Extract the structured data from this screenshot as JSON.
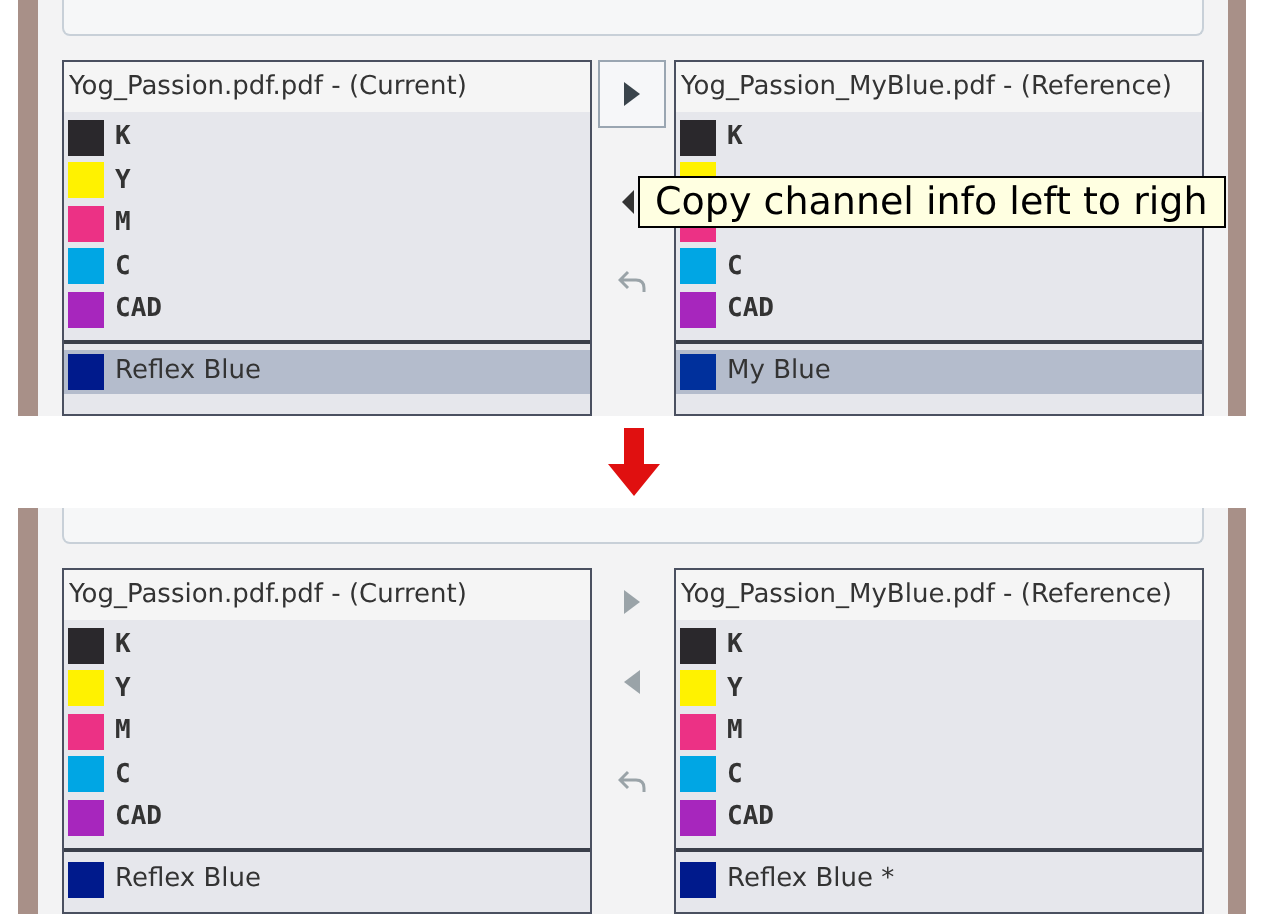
{
  "panels": [
    {
      "lists": [
        {
          "title": "Yog_Passion.pdf.pdf - (Current)",
          "channels": [
            {
              "name": "K",
              "color": "#2a282c"
            },
            {
              "name": "Y",
              "color": "#fff200"
            },
            {
              "name": "M",
              "color": "#ec3185"
            },
            {
              "name": "C",
              "color": "#00a6e4"
            },
            {
              "name": "CAD",
              "color": "#a726bd"
            }
          ],
          "spots": [
            {
              "name": "Reflex Blue",
              "color": "#001a8c",
              "selected": true
            }
          ]
        },
        {
          "title": "Yog_Passion_MyBlue.pdf - (Reference)",
          "channels": [
            {
              "name": "K",
              "color": "#2a282c"
            },
            {
              "color": "#fff200"
            },
            {
              "color": "#ec3185"
            },
            {
              "name": "C",
              "color": "#00a6e4"
            },
            {
              "name": "CAD",
              "color": "#a726bd"
            }
          ],
          "spots": [
            {
              "name": "My Blue",
              "color": "#00309c",
              "selected": true
            }
          ]
        }
      ],
      "buttons": [
        {
          "kind": "right",
          "disabled": false,
          "hovered": true
        },
        {
          "kind": "undo",
          "disabled": true,
          "hovered": false
        }
      ],
      "tooltip": "Copy channel info left to righ"
    },
    {
      "lists": [
        {
          "title": "Yog_Passion.pdf.pdf - (Current)",
          "channels": [
            {
              "name": "K",
              "color": "#2a282c"
            },
            {
              "name": "Y",
              "color": "#fff200"
            },
            {
              "name": "M",
              "color": "#ec3185"
            },
            {
              "name": "C",
              "color": "#00a6e4"
            },
            {
              "name": "CAD",
              "color": "#a726bd"
            }
          ],
          "spots": [
            {
              "name": "Reflex Blue",
              "color": "#001a8c",
              "selected": false
            }
          ]
        },
        {
          "title": "Yog_Passion_MyBlue.pdf - (Reference)",
          "channels": [
            {
              "name": "K",
              "color": "#2a282c"
            },
            {
              "name": "Y",
              "color": "#fff200"
            },
            {
              "name": "M",
              "color": "#ec3185"
            },
            {
              "name": "C",
              "color": "#00a6e4"
            },
            {
              "name": "CAD",
              "color": "#a726bd"
            }
          ],
          "spots": [
            {
              "name": "Reflex Blue *",
              "color": "#001a8c",
              "selected": false
            }
          ]
        }
      ],
      "buttons": [
        {
          "kind": "right",
          "disabled": true,
          "hovered": false
        },
        {
          "kind": "left",
          "disabled": true,
          "hovered": false
        },
        {
          "kind": "undo",
          "disabled": true,
          "hovered": false
        }
      ]
    }
  ]
}
